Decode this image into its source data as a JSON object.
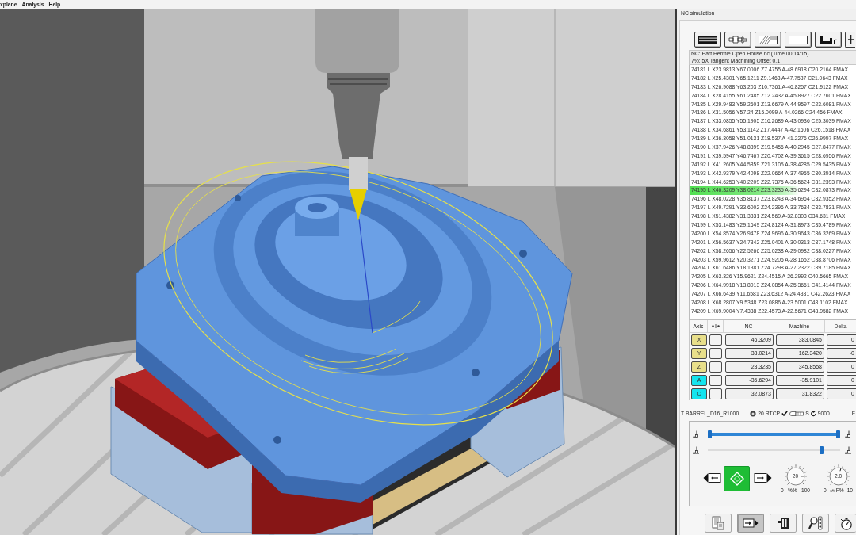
{
  "menu": [
    {
      "label": "xplane"
    },
    {
      "label": "Analysis"
    },
    {
      "label": "Help"
    }
  ],
  "nc_simulation": {
    "title": "NC simulation",
    "program": "NC: Part Hermle Open House.nc (Time 00:14:15)",
    "operation": "7%: 5X Tangent Machining Offset 0.1",
    "nc_lines": [
      {
        "text": "74181 L X23.9813 Y67.0006 Z7.4755 A-48.6918 C20.2164 FMAX",
        "selected": false
      },
      {
        "text": "74182 L X25.4301 Y65.1211 Z9.1468 A-47.7587 C21.0643 FMAX",
        "selected": false
      },
      {
        "text": "74183 L X26.9088 Y63.203 Z10.7361 A-46.8257 C21.9122 FMAX",
        "selected": false
      },
      {
        "text": "74184 L X28.4155 Y61.2485 Z12.2432 A-45.8927 C22.7601 FMAX",
        "selected": false
      },
      {
        "text": "74185 L X29.9483 Y59.2601 Z13.6679 A-44.9597 C23.6081 FMAX",
        "selected": false
      },
      {
        "text": "74186 L X31.5056 Y57.24 Z15.0099 A-44.0266 C24.456 FMAX",
        "selected": false
      },
      {
        "text": "74187 L X33.0855 Y55.1905 Z16.2689 A-43.0936 C25.3039 FMAX",
        "selected": false
      },
      {
        "text": "74188 L X34.6861 Y53.1142 Z17.4447 A-42.1606 C26.1518 FMAX",
        "selected": false
      },
      {
        "text": "74189 L X36.3058 Y51.0131 Z18.537 A-41.2276 C26.9997 FMAX",
        "selected": false
      },
      {
        "text": "74190 L X37.9426 Y48.8899 Z19.5456 A-40.2945 C27.8477 FMAX",
        "selected": false
      },
      {
        "text": "74191 L X39.5947 Y46.7467 Z20.4702 A-39.3615 C28.6956 FMAX",
        "selected": false
      },
      {
        "text": "74192 L X41.2605 Y44.5859 Z21.3105 A-38.4285 C29.5435 FMAX",
        "selected": false
      },
      {
        "text": "74193 L X42.9379 Y42.4098 Z22.0664 A-37.4955 C30.3914 FMAX",
        "selected": false
      },
      {
        "text": "74194 L X44.6253 Y40.2209 Z22.7375 A-36.5624 C31.2393 FMAX",
        "selected": false
      },
      {
        "text": "74195 L X46.3209 Y38.0214 Z23.3235 A-35.6294 C32.0873 FMAX",
        "selected": true
      },
      {
        "text": "74196 L X48.0228 Y35.8137 Z23.8243 A-34.6964 C32.9352 FMAX",
        "selected": false
      },
      {
        "text": "74197 L X49.7291 Y33.6002 Z24.2396 A-33.7634 C33.7831 FMAX",
        "selected": false
      },
      {
        "text": "74198 L X51.4382 Y31.3831 Z24.569 A-32.8303 C34.631 FMAX",
        "selected": false
      },
      {
        "text": "74199 L X53.1483 Y29.1649 Z24.8124 A-31.8973 C35.4789 FMAX",
        "selected": false
      },
      {
        "text": "74200 L X54.8574 Y26.9478 Z24.9696 A-30.9643 C36.3269 FMAX",
        "selected": false
      },
      {
        "text": "74201 L X56.5637 Y24.7342 Z25.0401 A-30.0313 C37.1748 FMAX",
        "selected": false
      },
      {
        "text": "74202 L X58.2656 Y22.5266 Z25.0238 A-29.0982 C38.0227 FMAX",
        "selected": false
      },
      {
        "text": "74203 L X59.9612 Y20.3271 Z24.9205 A-28.1652 C38.8706 FMAX",
        "selected": false
      },
      {
        "text": "74204 L X61.6486 Y18.1381 Z24.7298 A-27.2322 C39.7185 FMAX",
        "selected": false
      },
      {
        "text": "74205 L X63.326 Y15.9621 Z24.4515 A-26.2992 C40.5665 FMAX",
        "selected": false
      },
      {
        "text": "74206 L X64.9918 Y13.8013 Z24.0854 A-25.3661 C41.4144 FMAX",
        "selected": false
      },
      {
        "text": "74207 L X66.6439 Y11.6581 Z23.6312 A-24.4331 C42.2623 FMAX",
        "selected": false
      },
      {
        "text": "74208 L X68.2807 Y9.5348 Z23.0886 A-23.5001 C43.1102 FMAX",
        "selected": false
      },
      {
        "text": "74209 L X69.9004 Y7.4338 Z22.4573 A-22.5671 C43.9582 FMAX",
        "selected": false
      }
    ],
    "axes": {
      "columns": [
        "Axis",
        "NC",
        "Machine",
        "Delta"
      ],
      "rows": [
        {
          "axis": "X",
          "color": "#e8df8a",
          "checked": false,
          "nc": "46.3209",
          "machine": "383.0845",
          "delta": "0"
        },
        {
          "axis": "Y",
          "color": "#e8df8a",
          "checked": false,
          "nc": "38.0214",
          "machine": "162.3420",
          "delta": "-0"
        },
        {
          "axis": "Z",
          "color": "#e8df8a",
          "checked": false,
          "nc": "23.3235",
          "machine": "345.8558",
          "delta": "0"
        },
        {
          "axis": "A",
          "color": "#14e4ee",
          "checked": false,
          "nc": "-35.6294",
          "machine": "-35.9101",
          "delta": "0"
        },
        {
          "axis": "C",
          "color": "#14e4ee",
          "checked": false,
          "nc": "32.0873",
          "machine": "31.8322",
          "delta": "0"
        }
      ]
    },
    "tool_status": {
      "tool": "T BARREL_D16_R1000",
      "tool_number": "20",
      "rtcp": {
        "label": "RTCP",
        "on": true
      },
      "spindle_label": "S",
      "spindle_speed": "9000",
      "feed_label": "F"
    },
    "sliders": [
      {
        "kind": "range",
        "level": 1
      },
      {
        "kind": "position",
        "level": 0.86
      }
    ],
    "dials": [
      {
        "kind": "percent",
        "value": "20",
        "min": "0",
        "unit": "%%",
        "max": "100",
        "level": 0.83
      },
      {
        "kind": "feed",
        "value": "2.0",
        "min": "0",
        "unit": "F%",
        "max": "10",
        "level": 0.56
      }
    ],
    "bottom_toolbar": [
      {
        "pressed": false
      },
      {
        "pressed": true
      },
      {
        "pressed": false
      },
      {
        "pressed": false
      },
      {
        "pressed": false
      }
    ]
  }
}
